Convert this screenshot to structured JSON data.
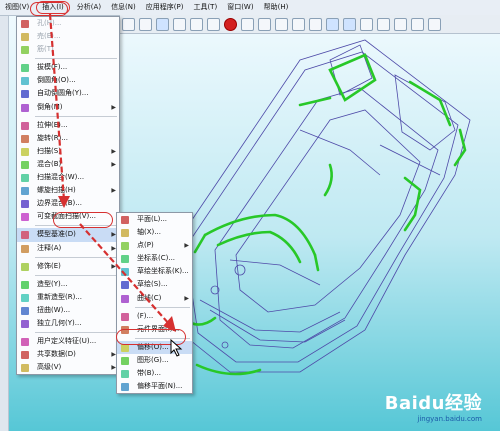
{
  "menubar": {
    "items": [
      "视图(V)",
      "插入(I)",
      "分析(A)",
      "信息(N)",
      "应用程序(P)",
      "工具(T)",
      "窗口(W)",
      "帮助(H)"
    ]
  },
  "insert_menu": {
    "items": [
      {
        "label": "孔(H)...",
        "dim": true
      },
      {
        "label": "売(E)...",
        "dim": true
      },
      {
        "label": "筋(T)",
        "dim": true
      },
      {
        "label": "拔模(F)..."
      },
      {
        "label": "倒圆角(O)..."
      },
      {
        "label": "自动倒圆角(Y)..."
      },
      {
        "label": "倒角(M)",
        "arrow": true
      },
      {
        "label": "拉伸(E)..."
      },
      {
        "label": "旋转(R)..."
      },
      {
        "label": "扫描(S)",
        "arrow": true
      },
      {
        "label": "混合(B)",
        "arrow": true
      },
      {
        "label": "扫描混合(W)..."
      },
      {
        "label": "螺旋扫描(H)",
        "arrow": true
      },
      {
        "label": "边界混合(B)..."
      },
      {
        "label": "可变截面扫描(V)..."
      },
      {
        "label": "模型基准(D)",
        "arrow": true,
        "highlight": true
      },
      {
        "label": "注释(A)",
        "arrow": true
      },
      {
        "label": "修饰(E)",
        "arrow": true
      },
      {
        "label": "造型(Y)..."
      },
      {
        "label": "重新造型(R)..."
      },
      {
        "label": "扭曲(W)..."
      },
      {
        "label": "独立几何(Y)..."
      },
      {
        "label": "用户定义特征(U)..."
      },
      {
        "label": "共享数据(D)",
        "arrow": true
      },
      {
        "label": "高级(V)",
        "arrow": true
      }
    ]
  },
  "datum_menu": {
    "items": [
      {
        "label": "平面(L)..."
      },
      {
        "label": "轴(X)..."
      },
      {
        "label": "点(P)",
        "arrow": true
      },
      {
        "label": "坐标系(C)..."
      },
      {
        "label": "草绘坐标系(K)..."
      },
      {
        "label": "草绘(S)..."
      },
      {
        "label": "曲线(C)",
        "arrow": true
      },
      {
        "label": "(F)..."
      },
      {
        "label": "元件界面(I)..."
      },
      {
        "label": "偏移(O)...",
        "highlight": true
      },
      {
        "label": "图形(G)..."
      },
      {
        "label": "带(B)..."
      },
      {
        "label": "偏移平面(N)..."
      }
    ]
  },
  "watermark": {
    "brand": "Baidu经验",
    "url": "jingyan.baidu.com"
  },
  "colors": {
    "accent": "#d63030",
    "model_green": "#28c828",
    "menu_highlight": "#c9dcf5"
  }
}
